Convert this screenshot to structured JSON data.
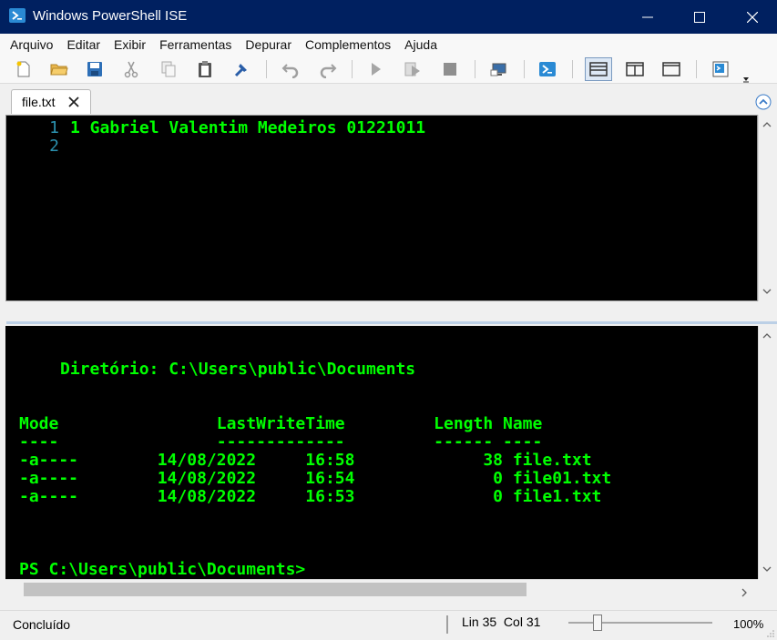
{
  "window": {
    "title": "Windows PowerShell ISE",
    "title_bar_color": "#002060"
  },
  "menu": [
    "Arquivo",
    "Editar",
    "Exibir",
    "Ferramentas",
    "Depurar",
    "Complementos",
    "Ajuda"
  ],
  "toolbar": {
    "icons": [
      "new-file-icon",
      "open-folder-icon",
      "save-icon",
      "cut-icon",
      "copy-icon",
      "paste-icon",
      "clear-console-icon",
      "undo-icon",
      "redo-icon",
      "run-icon",
      "run-selection-icon",
      "stop-icon",
      "remote-powershell-icon",
      "powershell-icon",
      "show-script-top-icon",
      "show-script-right-icon",
      "show-script-max-icon",
      "show-command-addon-icon",
      "toolbar-overflow-icon"
    ]
  },
  "tab": {
    "label": "file.txt"
  },
  "editor": {
    "line_numbers": [
      "1",
      "2"
    ],
    "lines": [
      "1 Gabriel Valentim Medeiros 01221011",
      ""
    ],
    "text_color": "#00ff00",
    "line_number_color": "#2b91af"
  },
  "console": {
    "directory_line": "Diretório: C:\\Users\\public\\Documents",
    "header": "Mode                LastWriteTime         Length Name",
    "underline": "----                -------------         ------ ----",
    "rows": [
      "-a----        14/08/2022     16:58             38 file.txt",
      "-a----        14/08/2022     16:54              0 file01.txt",
      "-a----        14/08/2022     16:53              0 file1.txt"
    ],
    "prompt": "PS C:\\Users\\public\\Documents>",
    "text_color": "#00ff00"
  },
  "status": {
    "text": "Concluído",
    "line_col": "Lin 35  Col 31",
    "zoom": "100%",
    "zoom_level_fraction": 0.2
  }
}
